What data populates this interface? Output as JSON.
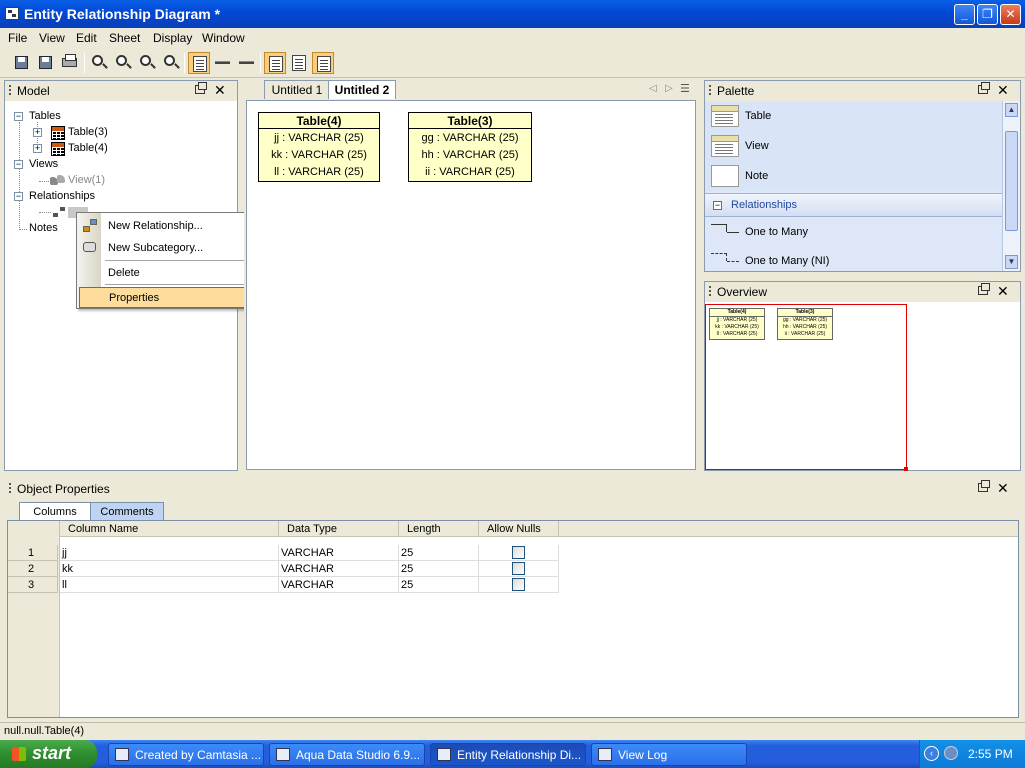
{
  "window": {
    "title": "Entity Relationship Diagram *"
  },
  "menu": [
    "File",
    "View",
    "Edit",
    "Sheet",
    "Display",
    "Window"
  ],
  "model_panel": {
    "title": "Model",
    "tree": {
      "tables": "Tables",
      "table3": "Table(3)",
      "table4": "Table(4)",
      "views": "Views",
      "view1": "View(1)",
      "relationships": "Relationships",
      "notes": "Notes"
    }
  },
  "context_menu": {
    "items": [
      "New Relationship...",
      "New Subcategory...",
      "Delete",
      "Properties"
    ]
  },
  "editor": {
    "tabs": [
      "Untitled 1",
      "Untitled 2"
    ],
    "entities": [
      {
        "name": "Table(4)",
        "columns": [
          "jj : VARCHAR (25)",
          "kk : VARCHAR (25)",
          "ll : VARCHAR (25)"
        ]
      },
      {
        "name": "Table(3)",
        "columns": [
          "gg : VARCHAR (25)",
          "hh : VARCHAR (25)",
          "ii : VARCHAR (25)"
        ]
      }
    ]
  },
  "palette": {
    "title": "Palette",
    "items": [
      "Table",
      "View",
      "Note"
    ],
    "group": "Relationships",
    "relationships": [
      "One to Many",
      "One to Many (NI)"
    ]
  },
  "overview": {
    "title": "Overview",
    "accent_color": "#E00000"
  },
  "object_properties": {
    "title": "Object Properties",
    "tabs": [
      "Columns",
      "Comments"
    ],
    "headers": [
      "Column Name",
      "Data Type",
      "Length",
      "Allow Nulls"
    ],
    "rows": [
      {
        "num": "1",
        "name": "jj",
        "type": "VARCHAR",
        "length": "25"
      },
      {
        "num": "2",
        "name": "kk",
        "type": "VARCHAR",
        "length": "25"
      },
      {
        "num": "3",
        "name": "ll",
        "type": "VARCHAR",
        "length": "25"
      }
    ]
  },
  "status": {
    "text": "null.null.Table(4)"
  },
  "taskbar": {
    "start": "start",
    "buttons": [
      "Created by Camtasia ...",
      "Aqua Data Studio 6.9...",
      "Entity Relationship Di...",
      "View Log"
    ],
    "clock": "2:55 PM"
  }
}
